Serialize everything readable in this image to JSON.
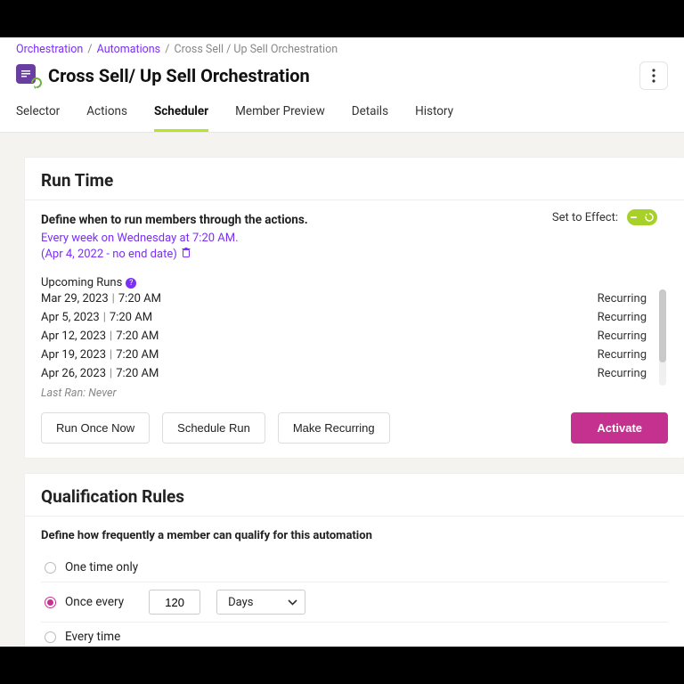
{
  "breadcrumb": {
    "root": "Orchestration",
    "section": "Automations",
    "current": "Cross Sell / Up Sell Orchestration"
  },
  "page_title": "Cross Sell/ Up Sell Orchestration",
  "tabs": [
    {
      "label": "Selector"
    },
    {
      "label": "Actions"
    },
    {
      "label": "Scheduler"
    },
    {
      "label": "Member Preview"
    },
    {
      "label": "Details"
    },
    {
      "label": "History"
    }
  ],
  "active_tab_index": 2,
  "run_time": {
    "heading": "Run Time",
    "define_label": "Define when to run members through the actions.",
    "schedule_line1": "Every week on Wednesday at 7:20 AM.",
    "schedule_line2": "(Apr 4, 2022 - no end date)",
    "set_to_effect_label": "Set to Effect:",
    "upcoming_label": "Upcoming Runs",
    "runs": [
      {
        "date": "Mar 29, 2023",
        "time": "7:20 AM",
        "type": "Recurring"
      },
      {
        "date": "Apr 5, 2023",
        "time": "7:20 AM",
        "type": "Recurring"
      },
      {
        "date": "Apr 12, 2023",
        "time": "7:20 AM",
        "type": "Recurring"
      },
      {
        "date": "Apr 19, 2023",
        "time": "7:20 AM",
        "type": "Recurring"
      },
      {
        "date": "Apr 26, 2023",
        "time": "7:20 AM",
        "type": "Recurring"
      }
    ],
    "last_ran": "Last Ran: Never",
    "buttons": {
      "run_once": "Run Once Now",
      "schedule_run": "Schedule Run",
      "make_recurring": "Make Recurring",
      "activate": "Activate"
    }
  },
  "qualification": {
    "heading": "Qualification Rules",
    "define_label": "Define how frequently a member can qualify for this automation",
    "options": {
      "one_time": "One time only",
      "once_every": "Once every",
      "every_time": "Every time"
    },
    "selected": "once_every",
    "interval_value": "120",
    "interval_unit": "Days"
  }
}
